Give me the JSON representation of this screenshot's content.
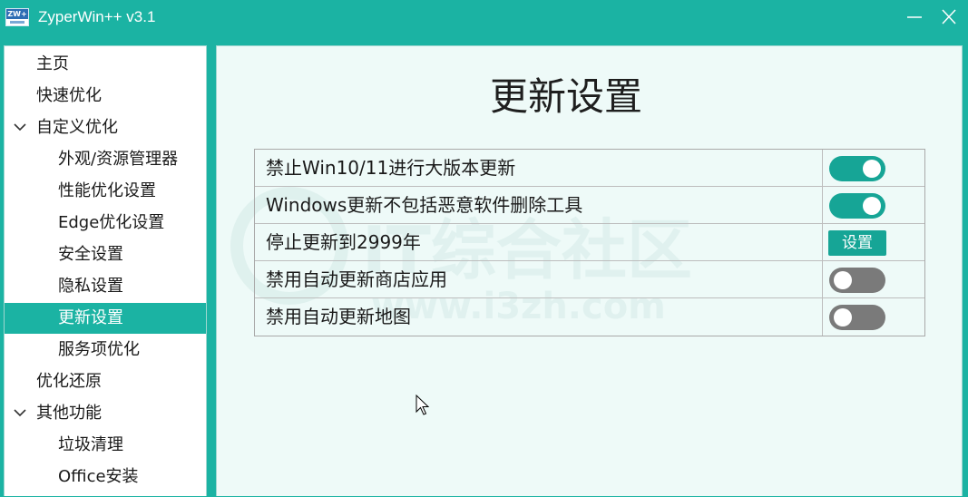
{
  "window": {
    "title": "ZyperWin++ v3.1",
    "icon_text": "ZW+",
    "accent_color": "#1bb3a3"
  },
  "sidebar": {
    "items": [
      {
        "label": "主页",
        "level": 0,
        "expandable": false,
        "selected": false
      },
      {
        "label": "快速优化",
        "level": 0,
        "expandable": false,
        "selected": false
      },
      {
        "label": "自定义优化",
        "level": 0,
        "expandable": true,
        "expanded": true,
        "selected": false
      },
      {
        "label": "外观/资源管理器",
        "level": 1,
        "expandable": false,
        "selected": false
      },
      {
        "label": "性能优化设置",
        "level": 1,
        "expandable": false,
        "selected": false
      },
      {
        "label": "Edge优化设置",
        "level": 1,
        "expandable": false,
        "selected": false
      },
      {
        "label": "安全设置",
        "level": 1,
        "expandable": false,
        "selected": false
      },
      {
        "label": "隐私设置",
        "level": 1,
        "expandable": false,
        "selected": false
      },
      {
        "label": "更新设置",
        "level": 1,
        "expandable": false,
        "selected": true
      },
      {
        "label": "服务项优化",
        "level": 1,
        "expandable": false,
        "selected": false
      },
      {
        "label": "优化还原",
        "level": 0,
        "expandable": false,
        "selected": false
      },
      {
        "label": "其他功能",
        "level": 0,
        "expandable": true,
        "expanded": true,
        "selected": false
      },
      {
        "label": "垃圾清理",
        "level": 1,
        "expandable": false,
        "selected": false
      },
      {
        "label": "Office安装",
        "level": 1,
        "expandable": false,
        "selected": false
      }
    ]
  },
  "main": {
    "title": "更新设置",
    "settings": [
      {
        "label": "禁止Win10/11进行大版本更新",
        "control": "toggle",
        "on": true
      },
      {
        "label": "Windows更新不包括恶意软件删除工具",
        "control": "toggle",
        "on": true
      },
      {
        "label": "停止更新到2999年",
        "control": "button",
        "button_label": "设置"
      },
      {
        "label": "禁用自动更新商店应用",
        "control": "toggle",
        "on": false
      },
      {
        "label": "禁用自动更新地图",
        "control": "toggle",
        "on": false
      }
    ]
  },
  "watermark": {
    "text": "IT综合社区",
    "url": "www.i3zh.com"
  }
}
